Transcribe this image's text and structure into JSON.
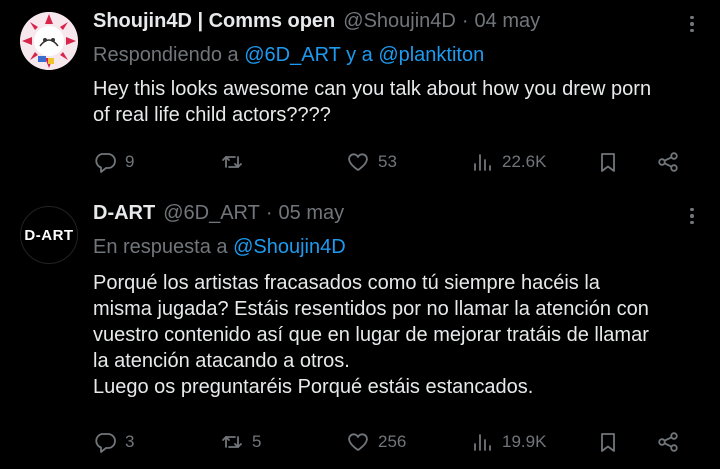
{
  "tweets": [
    {
      "author_name": "Shoujin4D | Comms open",
      "handle": "@Shoujin4D",
      "separator": "·",
      "date": "04 may",
      "reply_prefix": "Respondiendo a ",
      "reply_handles": [
        "@6D_ART",
        "@planktiton"
      ],
      "reply_joiner": " y a ",
      "text": "Hey this looks awesome can you talk about how you drew porn\nof real life child actors????",
      "replies": "9",
      "retweets": "",
      "likes": "53",
      "views": "22.6K"
    },
    {
      "author_name": "D-ART",
      "avatar_text": "D-ART",
      "handle": "@6D_ART",
      "separator": "·",
      "date": "05 may",
      "reply_prefix": "En respuesta a ",
      "reply_handles": [
        "@Shoujin4D"
      ],
      "text": "Porqué los artistas fracasados como tú siempre hacéis la\nmisma jugada? Estáis resentidos por no llamar la atención con\nvuestro contenido así que en lugar de mejorar tratáis de llamar\nla atención atacando a otros.\nLuego os preguntaréis Porqué estáis estancados.",
      "replies": "3",
      "retweets": "5",
      "likes": "256",
      "views": "19.9K"
    }
  ],
  "icons": [
    "reply-icon",
    "retweet-icon",
    "like-icon",
    "views-icon",
    "bookmark-icon",
    "share-icon",
    "more-icon"
  ],
  "colors": {
    "background": "#000000",
    "text": "#e7e9ea",
    "muted": "#71767b",
    "link": "#1d9bf0"
  }
}
